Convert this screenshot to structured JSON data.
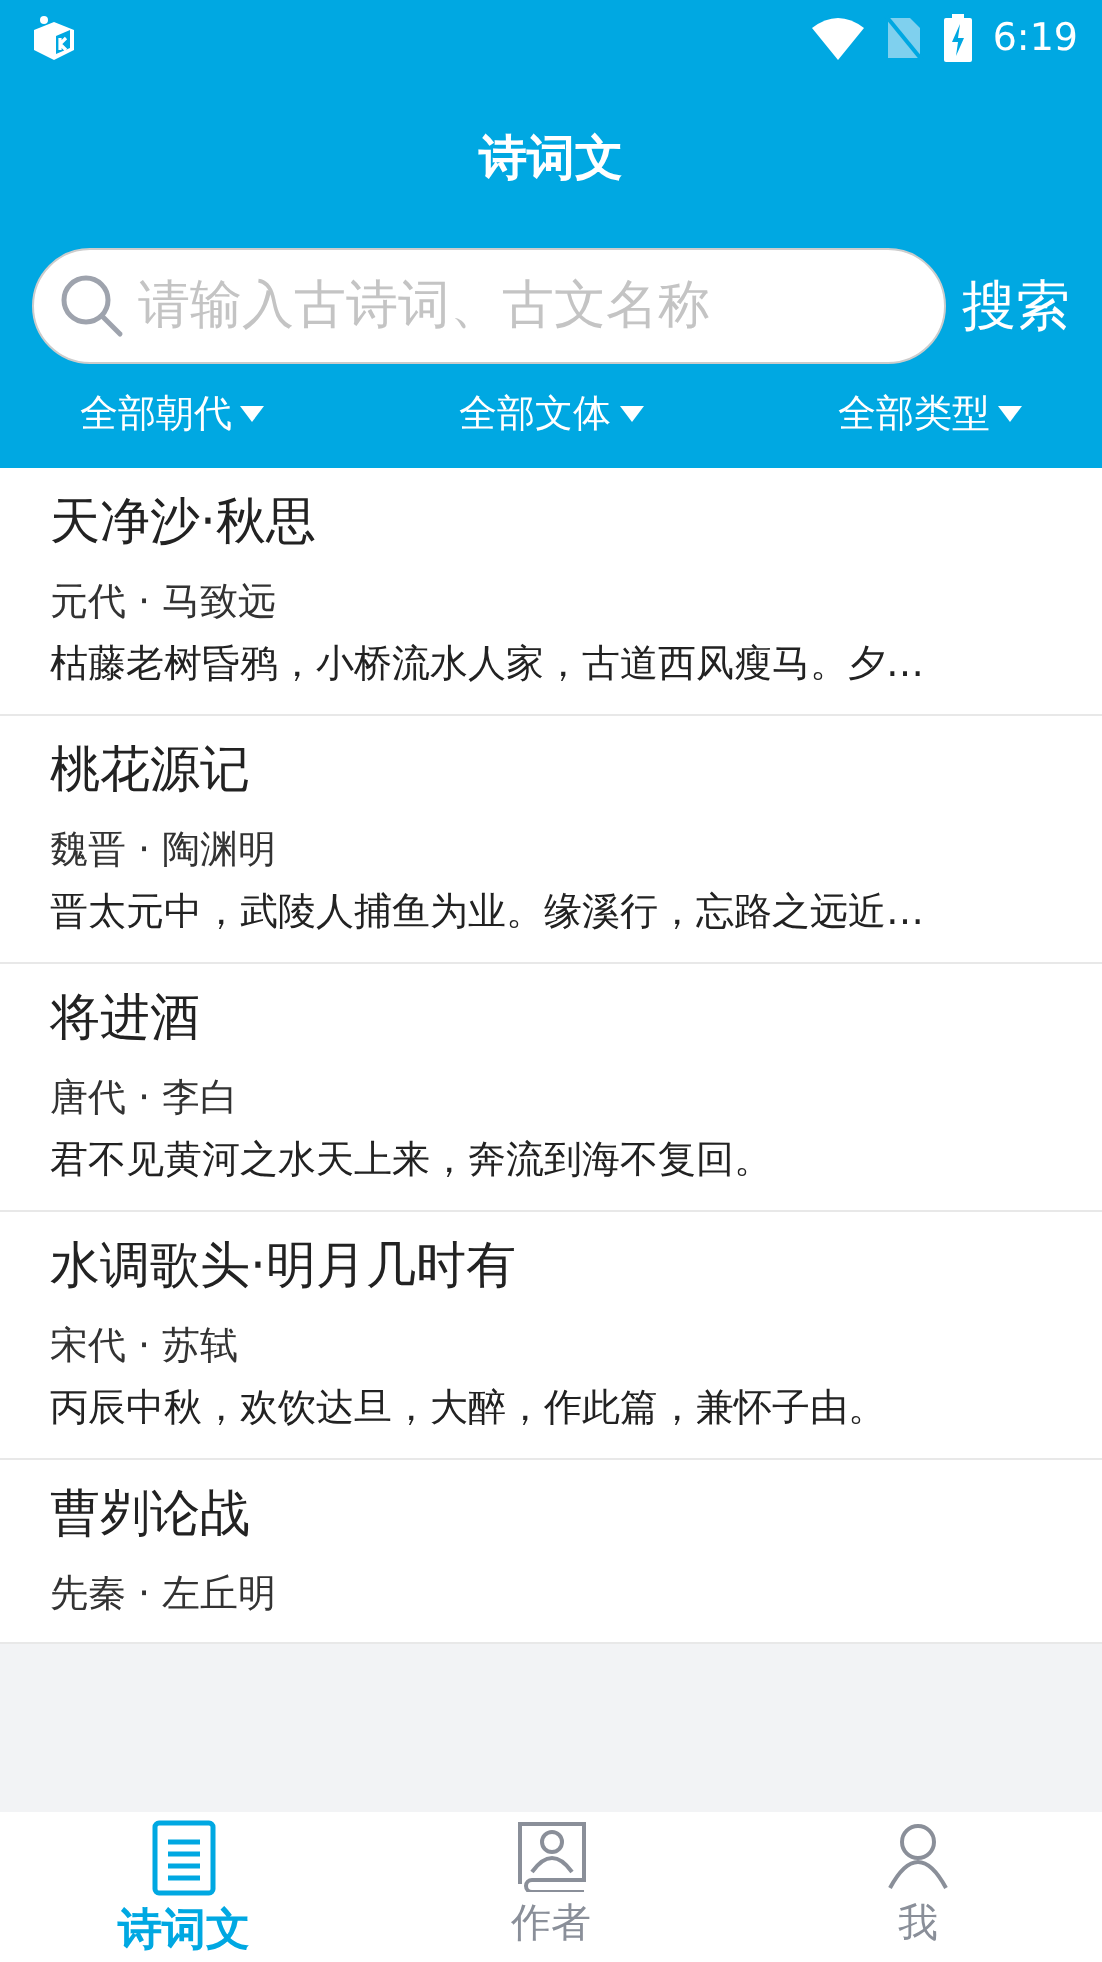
{
  "status_bar": {
    "time": "6:19"
  },
  "header": {
    "title": "诗词文"
  },
  "search": {
    "placeholder": "请输入古诗词、古文名称",
    "button": "搜索"
  },
  "filters": [
    {
      "label": "全部朝代"
    },
    {
      "label": "全部文体"
    },
    {
      "label": "全部类型"
    }
  ],
  "poems": [
    {
      "title": "天净沙·秋思",
      "meta": "元代 · 马致远",
      "excerpt": "枯藤老树昏鸦，小桥流水人家，古道西风瘦马。夕…"
    },
    {
      "title": "桃花源记",
      "meta": "魏晋 · 陶渊明",
      "excerpt": "晋太元中，武陵人捕鱼为业。缘溪行，忘路之远近…"
    },
    {
      "title": "将进酒",
      "meta": "唐代 · 李白",
      "excerpt": "君不见黄河之水天上来，奔流到海不复回。"
    },
    {
      "title": "水调歌头·明月几时有",
      "meta": "宋代 · 苏轼",
      "excerpt": "丙辰中秋，欢饮达旦，大醉，作此篇，兼怀子由。"
    },
    {
      "title": "曹刿论战",
      "meta": "先秦 · 左丘明"
    }
  ],
  "bottom_nav": [
    {
      "label": "诗词文",
      "kind": "document",
      "selected": true
    },
    {
      "label": "作者",
      "kind": "author",
      "selected": false
    },
    {
      "label": "我",
      "kind": "person",
      "selected": false
    }
  ]
}
